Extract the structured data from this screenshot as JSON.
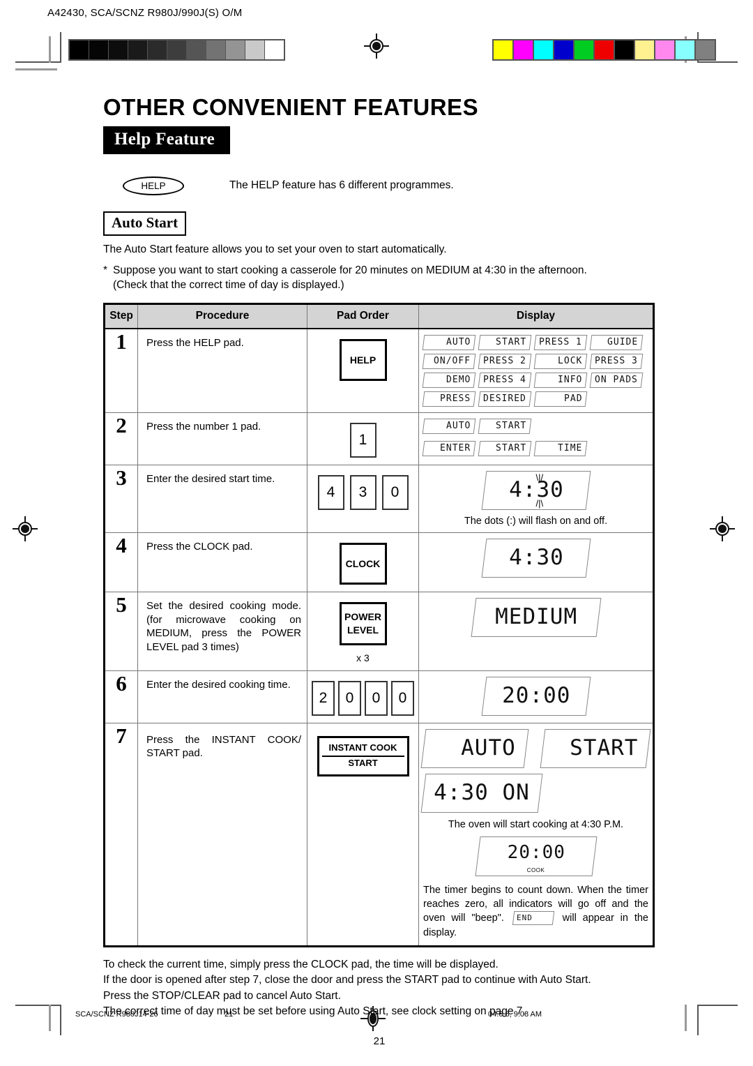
{
  "print_marks": {
    "header_code": "A42430, SCA/SCNZ R980J/990J(S) O/M",
    "grayscale_swatches": [
      "#000000",
      "#050505",
      "#0d0d0d",
      "#1a1a1a",
      "#2b2b2b",
      "#3d3d3d",
      "#555555",
      "#737373",
      "#949494",
      "#c9c9c9",
      "#ffffff"
    ],
    "color_swatches": [
      "#ffff00",
      "#ff00ff",
      "#00ffff",
      "#0000cc",
      "#00cc22",
      "#ee0000",
      "#000000",
      "#fff090",
      "#ff88ee",
      "#88ffff",
      "#808080"
    ]
  },
  "title": "OTHER CONVENIENT FEATURES",
  "section_banner": "Help Feature",
  "help_pad_label": "HELP",
  "help_intro": "The HELP feature has 6 different programmes.",
  "subsection": {
    "label": "Auto Start",
    "intro": "The Auto Start feature allows you to set your oven to start automatically.",
    "bullet_mark": "*",
    "bullet_line1": "Suppose you want to start cooking a casserole for 20 minutes on MEDIUM at 4:30 in the afternoon.",
    "bullet_line2": "(Check that the correct time of day is displayed.)"
  },
  "table": {
    "headers": [
      "Step",
      "Procedure",
      "Pad Order",
      "Display"
    ],
    "rows": [
      {
        "step": "1",
        "procedure": "Press the HELP pad.",
        "pad": {
          "type": "button",
          "label": "HELP"
        },
        "display_cells": [
          "AUTO",
          "START",
          "PRESS 1",
          "GUIDE",
          "ON/OFF",
          "PRESS 2",
          "LOCK",
          "PRESS 3",
          "DEMO",
          "PRESS 4",
          "INFO",
          "ON PADS",
          "PRESS",
          "DESIRED",
          "PAD"
        ]
      },
      {
        "step": "2",
        "procedure": "Press the number 1 pad.",
        "pad": {
          "type": "number",
          "keys": [
            "1"
          ]
        },
        "display_cells": [
          "AUTO",
          "START",
          "ENTER",
          "START",
          "TIME"
        ]
      },
      {
        "step": "3",
        "procedure": "Enter the desired start time.",
        "pad": {
          "type": "number",
          "keys": [
            "4",
            "3",
            "0"
          ]
        },
        "display_big": "4:30",
        "note": "The dots (:) will flash on and off."
      },
      {
        "step": "4",
        "procedure": "Press the CLOCK pad.",
        "pad": {
          "type": "button",
          "label": "CLOCK"
        },
        "display_big": "4:30"
      },
      {
        "step": "5",
        "procedure": "Set the desired cooking mode. (for microwave cooking on MEDIUM, press the POWER LEVEL pad 3 times)",
        "pad": {
          "type": "button2",
          "label_line1": "POWER",
          "label_line2": "LEVEL",
          "multiplier": "x 3"
        },
        "display_big": "MEDIUM"
      },
      {
        "step": "6",
        "procedure": "Enter the desired cooking time.",
        "pad": {
          "type": "number",
          "keys": [
            "2",
            "0",
            "0",
            "0"
          ]
        },
        "display_big": "20:00"
      },
      {
        "step": "7",
        "procedure": "Press the INSTANT COOK/ START pad.",
        "pad": {
          "type": "wide",
          "label_line1": "INSTANT COOK",
          "label_line2": "START"
        },
        "display_big_a": "AUTO",
        "display_big_b": "START",
        "display_big_c": "4:30 ON",
        "note1": "The oven will start cooking at 4:30 P.M.",
        "display_cook": "20:00",
        "display_cook_label": "COOK",
        "note2_part1": "The timer begins to count down. When the timer reaches zero, all indicators will go off and the oven will \"beep\".",
        "note2_lcd": "END",
        "note2_part2": "will appear in the display."
      }
    ]
  },
  "footer_notes": [
    "To check the current time, simply press the CLOCK pad, the time will be displayed.",
    "If the door is opened after step 7, close the door and press the START pad to continue with Auto Start.",
    "Press the STOP/CLEAR pad to cancel Auto Start.",
    "The correct time of day must be set before using Auto Start, see clock setting on page 7."
  ],
  "page_number": "21",
  "bottom_bar": {
    "doc_ref": "SCA/SCNZ R980J14-26",
    "page": "21",
    "timestamp": "04.6.8, 9:08 AM"
  }
}
